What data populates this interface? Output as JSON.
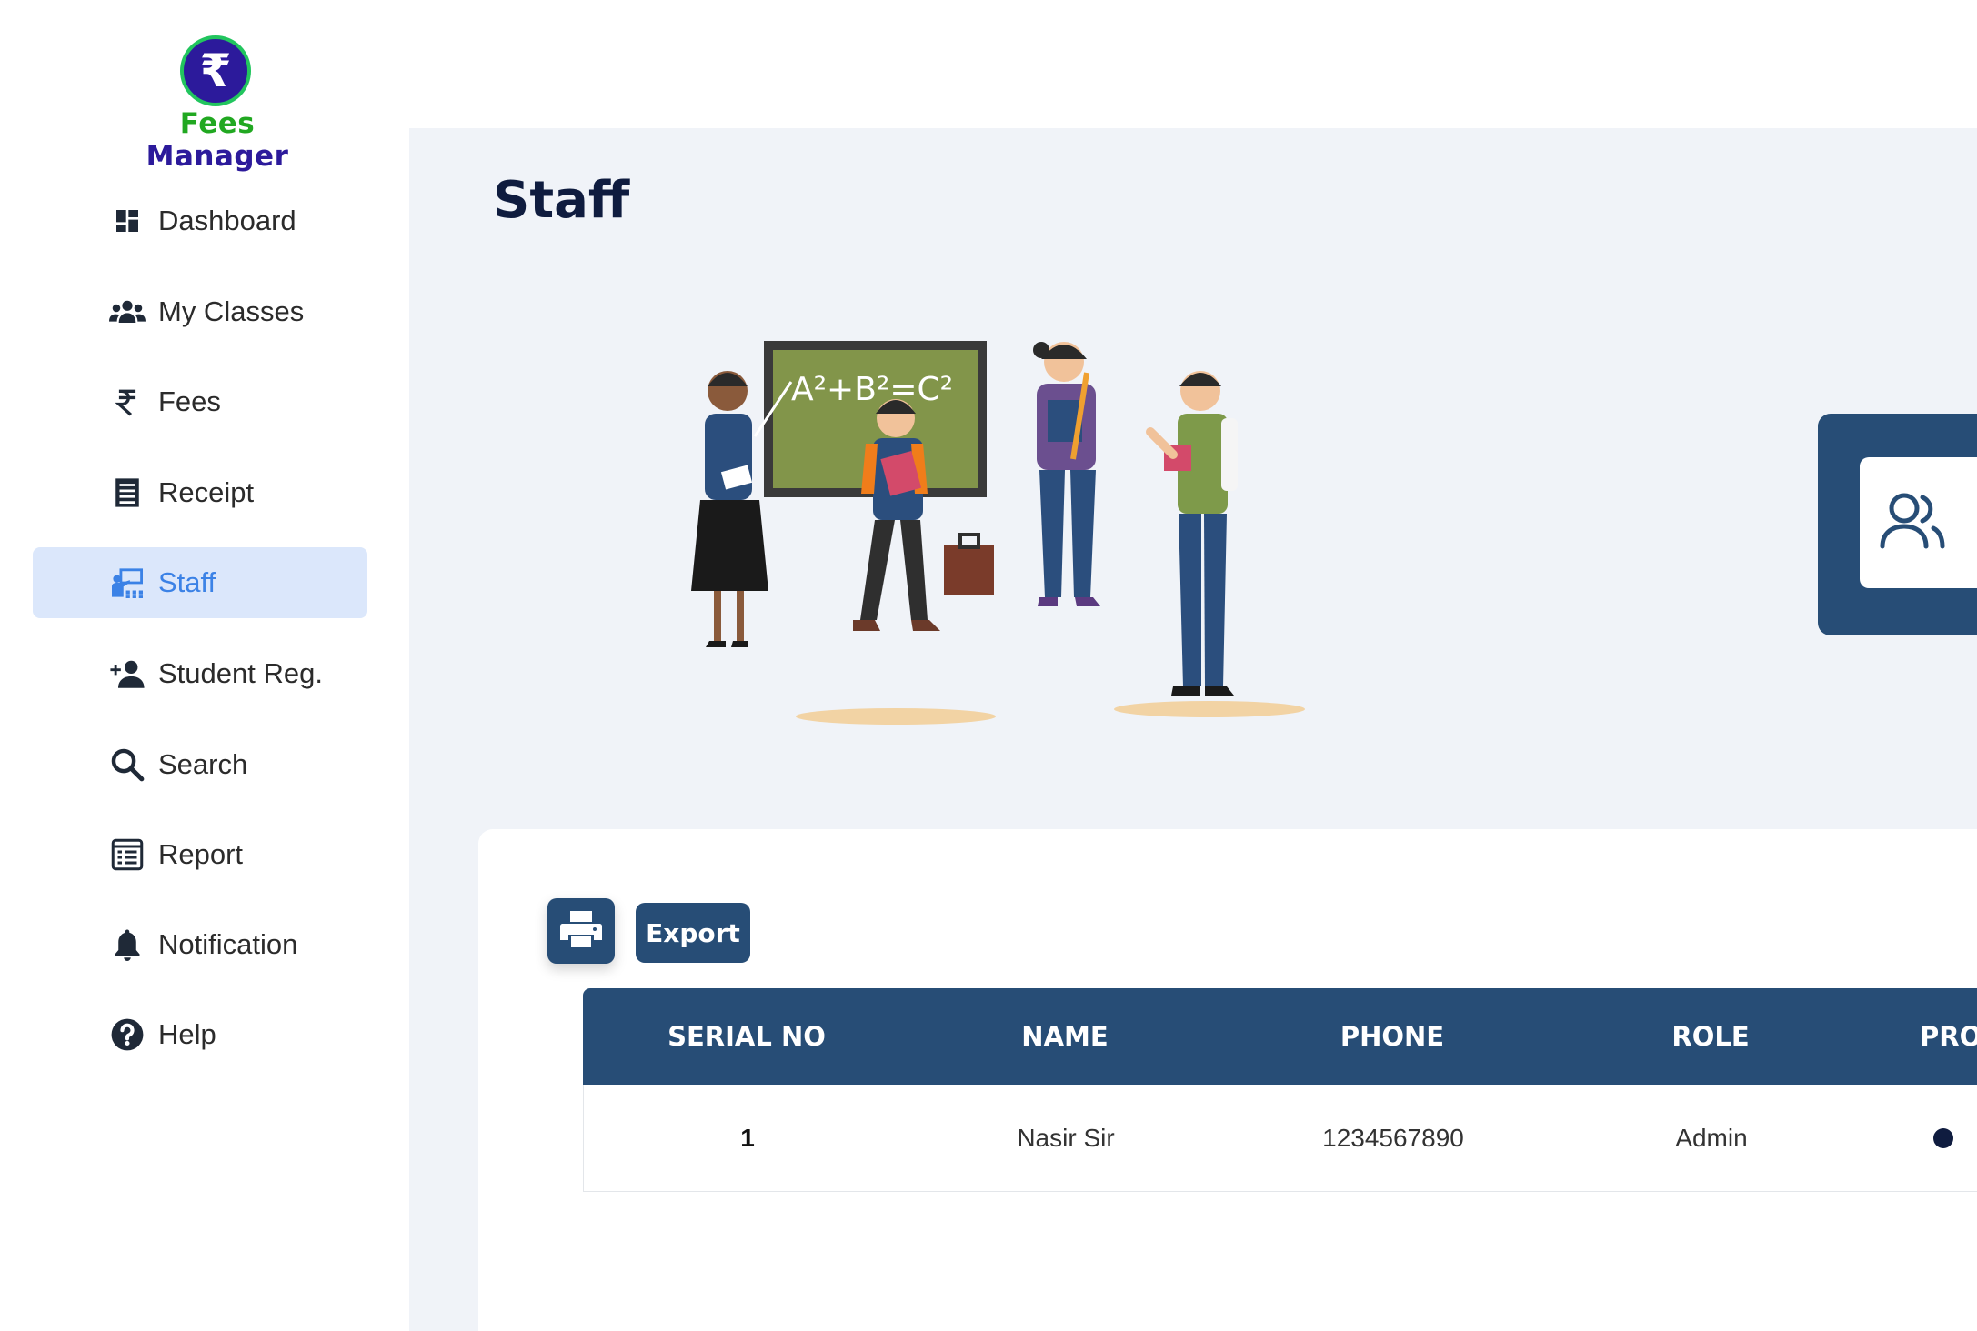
{
  "app": {
    "logo_symbol": "₹",
    "logo_word1": "Fees",
    "logo_word2": "Manager",
    "colors": {
      "brand_green": "#21a821",
      "brand_purple": "#2c1a9b",
      "primary": "#274d76",
      "active_bg": "#dbe7fb",
      "active_text": "#3b82e6"
    }
  },
  "sidebar": {
    "items": [
      {
        "label": "Dashboard",
        "icon": "dashboard-icon"
      },
      {
        "label": "My Classes",
        "icon": "users-icon"
      },
      {
        "label": "Fees",
        "icon": "rupee-icon"
      },
      {
        "label": "Receipt",
        "icon": "receipt-icon"
      },
      {
        "label": "Staff",
        "icon": "staff-icon",
        "active": true
      },
      {
        "label": "Student Reg.",
        "icon": "add-user-icon"
      },
      {
        "label": "Search",
        "icon": "search-icon"
      },
      {
        "label": "Report",
        "icon": "report-icon"
      },
      {
        "label": "Notification",
        "icon": "bell-icon"
      },
      {
        "label": "Help",
        "icon": "help-icon"
      }
    ]
  },
  "main": {
    "title": "Staff",
    "toolbar": {
      "export_label": "Export"
    },
    "table": {
      "headers": [
        "SERIAL NO",
        "NAME",
        "PHONE",
        "ROLE",
        "PRO"
      ],
      "rows": [
        {
          "serial": "1",
          "name": "Nasir Sir",
          "phone": "1234567890",
          "role": "Admin"
        }
      ]
    }
  }
}
